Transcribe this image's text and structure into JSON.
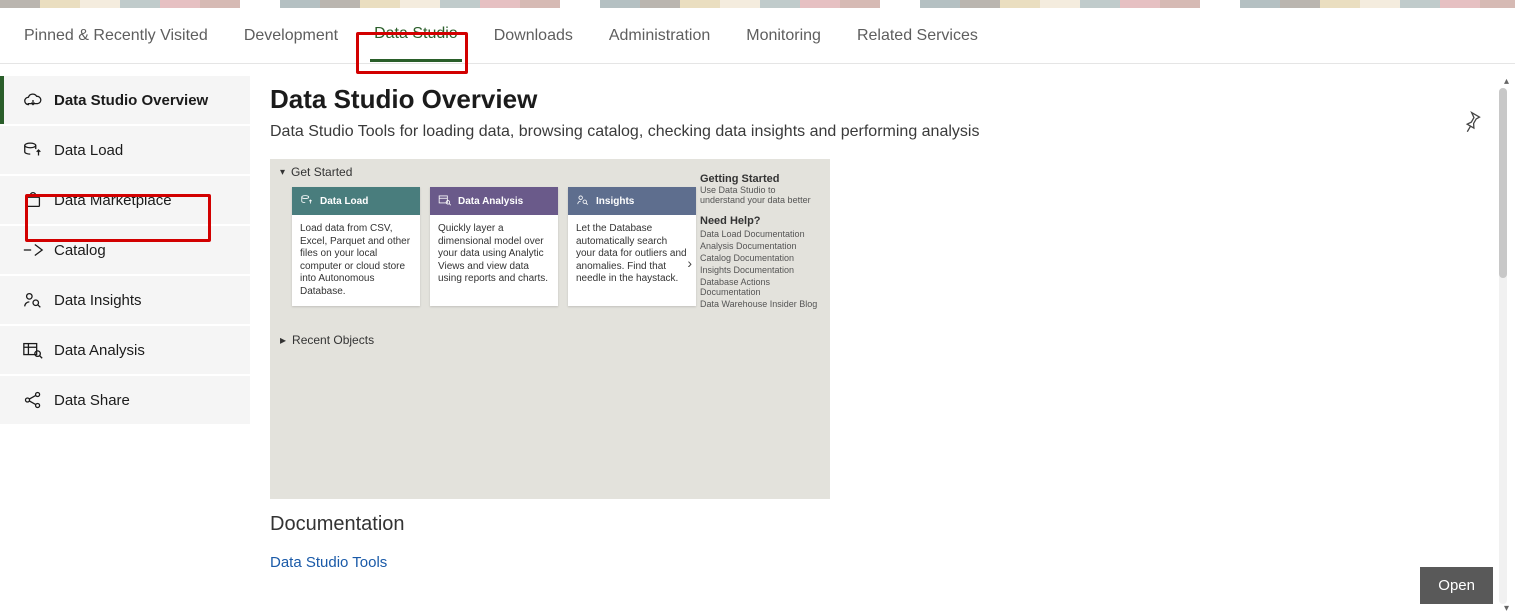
{
  "topnav": {
    "items": [
      {
        "label": "Pinned & Recently Visited"
      },
      {
        "label": "Development"
      },
      {
        "label": "Data Studio",
        "active": true
      },
      {
        "label": "Downloads"
      },
      {
        "label": "Administration"
      },
      {
        "label": "Monitoring"
      },
      {
        "label": "Related Services"
      }
    ]
  },
  "sidebar": {
    "items": [
      {
        "label": "Data Studio Overview",
        "active": true,
        "id": "overview"
      },
      {
        "label": "Data Load",
        "id": "data-load"
      },
      {
        "label": "Data Marketplace",
        "id": "data-marketplace"
      },
      {
        "label": "Catalog",
        "id": "catalog"
      },
      {
        "label": "Data Insights",
        "id": "data-insights"
      },
      {
        "label": "Data Analysis",
        "id": "data-analysis"
      },
      {
        "label": "Data Share",
        "id": "data-share"
      }
    ]
  },
  "page": {
    "title": "Data Studio Overview",
    "subtitle": "Data Studio Tools for loading data, browsing catalog, checking data insights and performing analysis"
  },
  "preview": {
    "get_started_label": "Get Started",
    "recent_label": "Recent Objects",
    "cards": [
      {
        "title": "Data Load",
        "body": "Load data from CSV, Excel, Parquet and other files on your local computer or cloud store into Autonomous Database."
      },
      {
        "title": "Data Analysis",
        "body": "Quickly layer a dimensional model over your data using Analytic Views and view data using reports and charts."
      },
      {
        "title": "Insights",
        "body": "Let the Database automatically search your data for outliers and anomalies. Find that needle in the haystack."
      }
    ],
    "right": {
      "h1": "Getting Started",
      "h1_sub": "Use Data Studio to understand your data better",
      "h2": "Need Help?",
      "links": [
        "Data Load Documentation",
        "Analysis Documentation",
        "Catalog Documentation",
        "Insights Documentation",
        "Database Actions Documentation",
        "Data Warehouse Insider Blog"
      ]
    }
  },
  "doc": {
    "heading": "Documentation",
    "link": "Data Studio Tools"
  },
  "open_label": "Open"
}
